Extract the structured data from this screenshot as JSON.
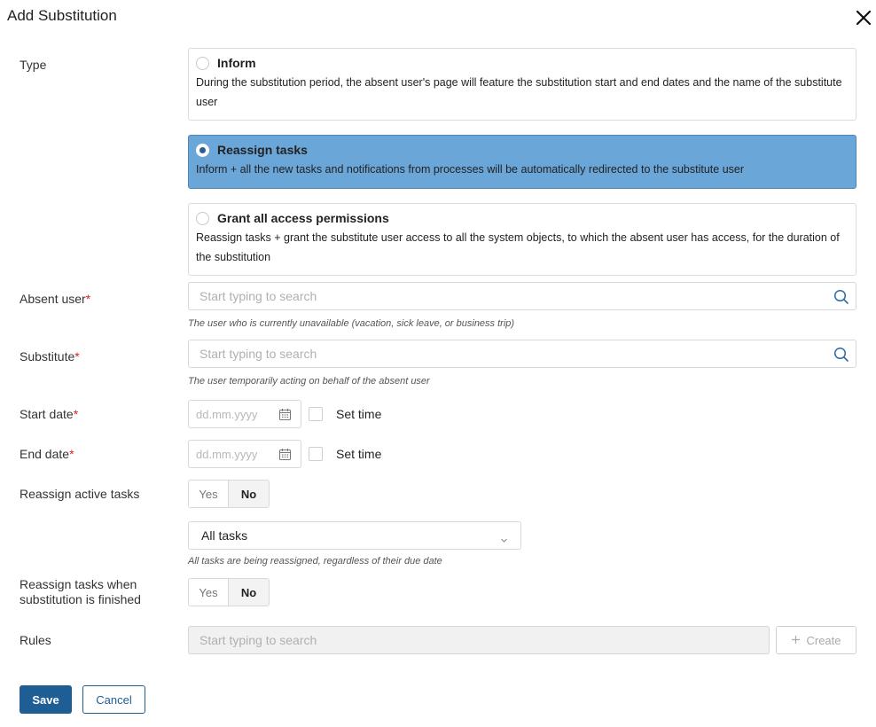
{
  "dialog": {
    "title": "Add Substitution",
    "close_icon": "close-icon"
  },
  "type": {
    "label": "Type",
    "options": [
      {
        "title": "Inform",
        "description": "During the substitution period, the absent user's page will feature the substitution start and end dates and the name of the substitute user",
        "selected": false
      },
      {
        "title": "Reassign tasks",
        "description": "Inform + all the new tasks and notifications from processes will be automatically redirected to the substitute user",
        "selected": true
      },
      {
        "title": "Grant all access permissions",
        "description": "Reassign tasks + grant the substitute user access to all the system objects, to which the absent user has access, for the duration of the substitution",
        "selected": false
      }
    ]
  },
  "absent_user": {
    "label": "Absent user",
    "required_mark": "*",
    "placeholder": "Start typing to search",
    "hint": "The user who is currently unavailable (vacation, sick leave, or business trip)"
  },
  "substitute": {
    "label": "Substitute",
    "required_mark": "*",
    "placeholder": "Start typing to search",
    "hint": "The user temporarily acting on behalf of the absent user"
  },
  "start_date": {
    "label": "Start date",
    "required_mark": "*",
    "placeholder": "dd.mm.yyyy",
    "set_time_label": "Set time",
    "set_time_checked": false
  },
  "end_date": {
    "label": "End date",
    "required_mark": "*",
    "placeholder": "dd.mm.yyyy",
    "set_time_label": "Set time",
    "set_time_checked": false
  },
  "reassign_active": {
    "label": "Reassign active tasks",
    "yes": "Yes",
    "no": "No",
    "selected": "No",
    "select_value": "All tasks",
    "hint": "All tasks are being reassigned, regardless of their due date"
  },
  "reassign_finished": {
    "label_line1": "Reassign tasks when",
    "label_line2": "substitution is finished",
    "yes": "Yes",
    "no": "No",
    "selected": "No"
  },
  "rules": {
    "label": "Rules",
    "placeholder": "Start typing to search",
    "create_label": "Create"
  },
  "footer": {
    "save_label": "Save",
    "cancel_label": "Cancel"
  },
  "colors": {
    "accent": "#1f5d95",
    "selected_card": "#6aa6d8",
    "required": "#dd2222"
  }
}
